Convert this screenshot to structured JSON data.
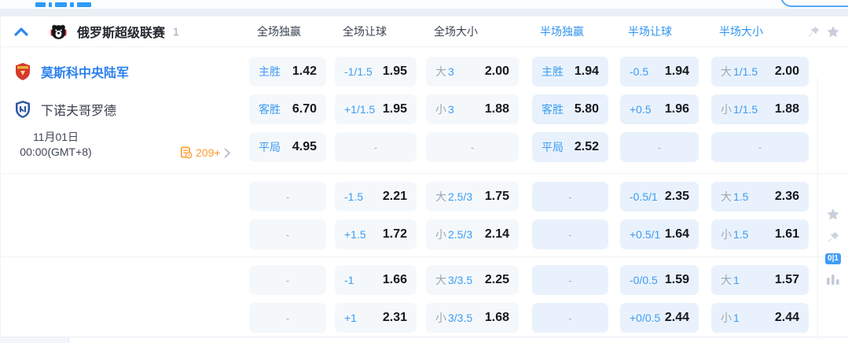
{
  "league": {
    "title": "俄罗斯超级联赛",
    "count": "1"
  },
  "columns": [
    {
      "label": "全场独赢",
      "tone": "dark"
    },
    {
      "label": "全场让球",
      "tone": "dark"
    },
    {
      "label": "全场大小",
      "tone": "dark"
    },
    {
      "label": "半场独赢",
      "tone": "half"
    },
    {
      "label": "半场让球",
      "tone": "half"
    },
    {
      "label": "半场大小",
      "tone": "half"
    }
  ],
  "match": {
    "home": "莫斯科中央陆军",
    "away": "下诺夫哥罗德",
    "date_line1": "11月01日",
    "date_line2": "00:00(GMT+8)",
    "more_count": "209+"
  },
  "rail": {
    "badge": "0|1"
  },
  "odds": {
    "groups": [
      [
        [
          {
            "label": "主胜",
            "value": "1.42"
          },
          {
            "label": "-1/1.5",
            "value": "1.95"
          },
          {
            "prefix": "大",
            "label": "3",
            "value": "2.00"
          },
          {
            "label": "主胜",
            "value": "1.94"
          },
          {
            "label": "-0.5",
            "value": "1.94"
          },
          {
            "prefix": "大",
            "label": "1/1.5",
            "value": "2.00"
          }
        ],
        [
          {
            "label": "客胜",
            "value": "6.70"
          },
          {
            "label": "+1/1.5",
            "value": "1.95"
          },
          {
            "prefix": "小",
            "label": "3",
            "value": "1.88"
          },
          {
            "label": "客胜",
            "value": "5.80"
          },
          {
            "label": "+0.5",
            "value": "1.96"
          },
          {
            "prefix": "小",
            "label": "1/1.5",
            "value": "1.88"
          }
        ],
        [
          {
            "label": "平局",
            "value": "4.95"
          },
          {
            "dash": "-"
          },
          {
            "dash": "-"
          },
          {
            "label": "平局",
            "value": "2.52"
          },
          {
            "dash": "-"
          },
          {
            "dash": "-"
          }
        ]
      ],
      [
        [
          {
            "dash": "-"
          },
          {
            "label": "-1.5",
            "value": "2.21"
          },
          {
            "prefix": "大",
            "label": "2.5/3",
            "value": "1.75"
          },
          {
            "dash": "-"
          },
          {
            "label": "-0.5/1",
            "value": "2.35"
          },
          {
            "prefix": "大",
            "label": "1.5",
            "value": "2.36"
          }
        ],
        [
          {
            "dash": "-"
          },
          {
            "label": "+1.5",
            "value": "1.72"
          },
          {
            "prefix": "小",
            "label": "2.5/3",
            "value": "2.14"
          },
          {
            "dash": "-"
          },
          {
            "label": "+0.5/1",
            "value": "1.64"
          },
          {
            "prefix": "小",
            "label": "1.5",
            "value": "1.61"
          }
        ]
      ],
      [
        [
          {
            "dash": "-"
          },
          {
            "label": "-1",
            "value": "1.66"
          },
          {
            "prefix": "大",
            "label": "3/3.5",
            "value": "2.25"
          },
          {
            "dash": "-"
          },
          {
            "label": "-0/0.5",
            "value": "1.59"
          },
          {
            "prefix": "大",
            "label": "1",
            "value": "1.57"
          }
        ],
        [
          {
            "dash": "-"
          },
          {
            "label": "+1",
            "value": "2.31"
          },
          {
            "prefix": "小",
            "label": "3/3.5",
            "value": "1.68"
          },
          {
            "dash": "-"
          },
          {
            "label": "+0/0.5",
            "value": "2.44"
          },
          {
            "prefix": "小",
            "label": "1",
            "value": "2.44"
          }
        ]
      ]
    ]
  },
  "colors": {
    "accent_blue": "#2f9bf5",
    "label_blue": "#3d9cf3",
    "value_dark": "#15171c",
    "cell_ft_bg": "#f5f8fb",
    "cell_ht_bg": "#e9f2fc",
    "orange": "#ff9a2e",
    "gray_icon": "#ccd3de"
  }
}
